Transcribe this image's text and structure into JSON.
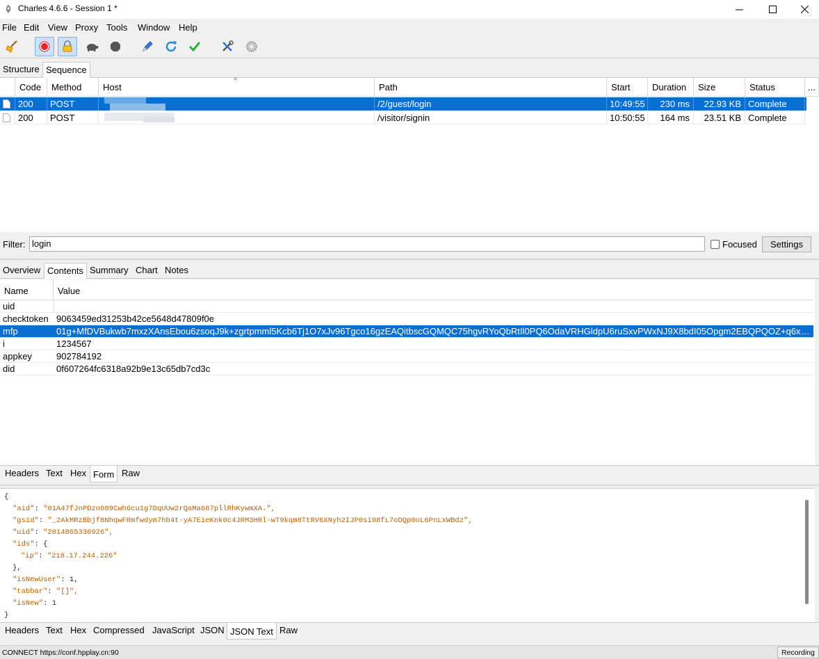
{
  "window": {
    "title": "Charles 4.6.6 - Session 1 *"
  },
  "menu": [
    "File",
    "Edit",
    "View",
    "Proxy",
    "Tools",
    "Window",
    "Help"
  ],
  "top_tabs": [
    "Structure",
    "Sequence"
  ],
  "table": {
    "columns": [
      "Code",
      "Method",
      "Host",
      "Path",
      "Start",
      "Duration",
      "Size",
      "Status",
      "..."
    ],
    "rows": [
      {
        "code": "200",
        "method": "POST",
        "path": "/2/guest/login",
        "start": "10:49:55",
        "duration": "230 ms",
        "size": "22.93 KB",
        "status": "Complete"
      },
      {
        "code": "200",
        "method": "POST",
        "path": "/visitor/signin",
        "start": "10:50:55",
        "duration": "164 ms",
        "size": "23.51 KB",
        "status": "Complete"
      }
    ]
  },
  "filter": {
    "label": "Filter:",
    "value": "login",
    "focused_label": "Focused",
    "settings_label": "Settings"
  },
  "detail_tabs": [
    "Overview",
    "Contents",
    "Summary",
    "Chart",
    "Notes"
  ],
  "form": {
    "headers": [
      "Name",
      "Value"
    ],
    "rows": [
      {
        "name": "uid",
        "value": ""
      },
      {
        "name": "checktoken",
        "value": "9063459ed31253b42ce5648d47809f0e"
      },
      {
        "name": "mfp",
        "value": "01g+MfDVBukwb7mxzXAnsEbou6zsoqJ9k+zgrtpmml5Kcb6Tj1O7xJv96Tgco16gzEAQitbscGQMQC75hgvRYoQbRtIl0PQ6OdaVRHGldpU6ruSxvPWxNJ9X8bdI05Opgm2EBQPQOZ+q6xlAxG..."
      },
      {
        "name": "i",
        "value": "1234567"
      },
      {
        "name": "appkey",
        "value": "902784192"
      },
      {
        "name": "did",
        "value": "0f607264fc6318a92b9e13c65db7cd3c"
      }
    ]
  },
  "request_tabs": [
    "Headers",
    "Text",
    "Hex",
    "Form",
    "Raw"
  ],
  "json_lines": [
    {
      "indent": 0,
      "text": "{"
    },
    {
      "indent": 1,
      "key": "\"aid\"",
      "value": "\"01A47fJnPDzn089Cwh6cu1g7DqUUw2rQaMa687pllRhKywmXA.\","
    },
    {
      "indent": 1,
      "key": "\"gsid\"",
      "value": "\"_2AkMRzBbjf8NhqwFRmfwdym7hb4t-yA7EieKnk0c4JRM3HRl-wT9kqm8TtRV6XNyh2IJP0si98fL7oDQp0oL6PnLxWBdz\","
    },
    {
      "indent": 1,
      "key": "\"uid\"",
      "value": "\"2014865336926\","
    },
    {
      "indent": 1,
      "key": "\"ids\"",
      "value": "{"
    },
    {
      "indent": 2,
      "key": "\"ip\"",
      "value": "\"218.17.244.226\""
    },
    {
      "indent": 1,
      "text": "},"
    },
    {
      "indent": 1,
      "key": "\"isNewUser\"",
      "value": "1,"
    },
    {
      "indent": 1,
      "key": "\"tabbar\"",
      "value": "\"[]\","
    },
    {
      "indent": 1,
      "key": "\"isNew\"",
      "value": "1"
    },
    {
      "indent": 0,
      "text": "}"
    }
  ],
  "response_tabs": [
    "Headers",
    "Text",
    "Hex",
    "Compressed",
    "JavaScript",
    "JSON",
    "JSON Text",
    "Raw"
  ],
  "status": {
    "connect": "CONNECT https://conf.hpplay.cn:90",
    "recording": "Recording"
  }
}
